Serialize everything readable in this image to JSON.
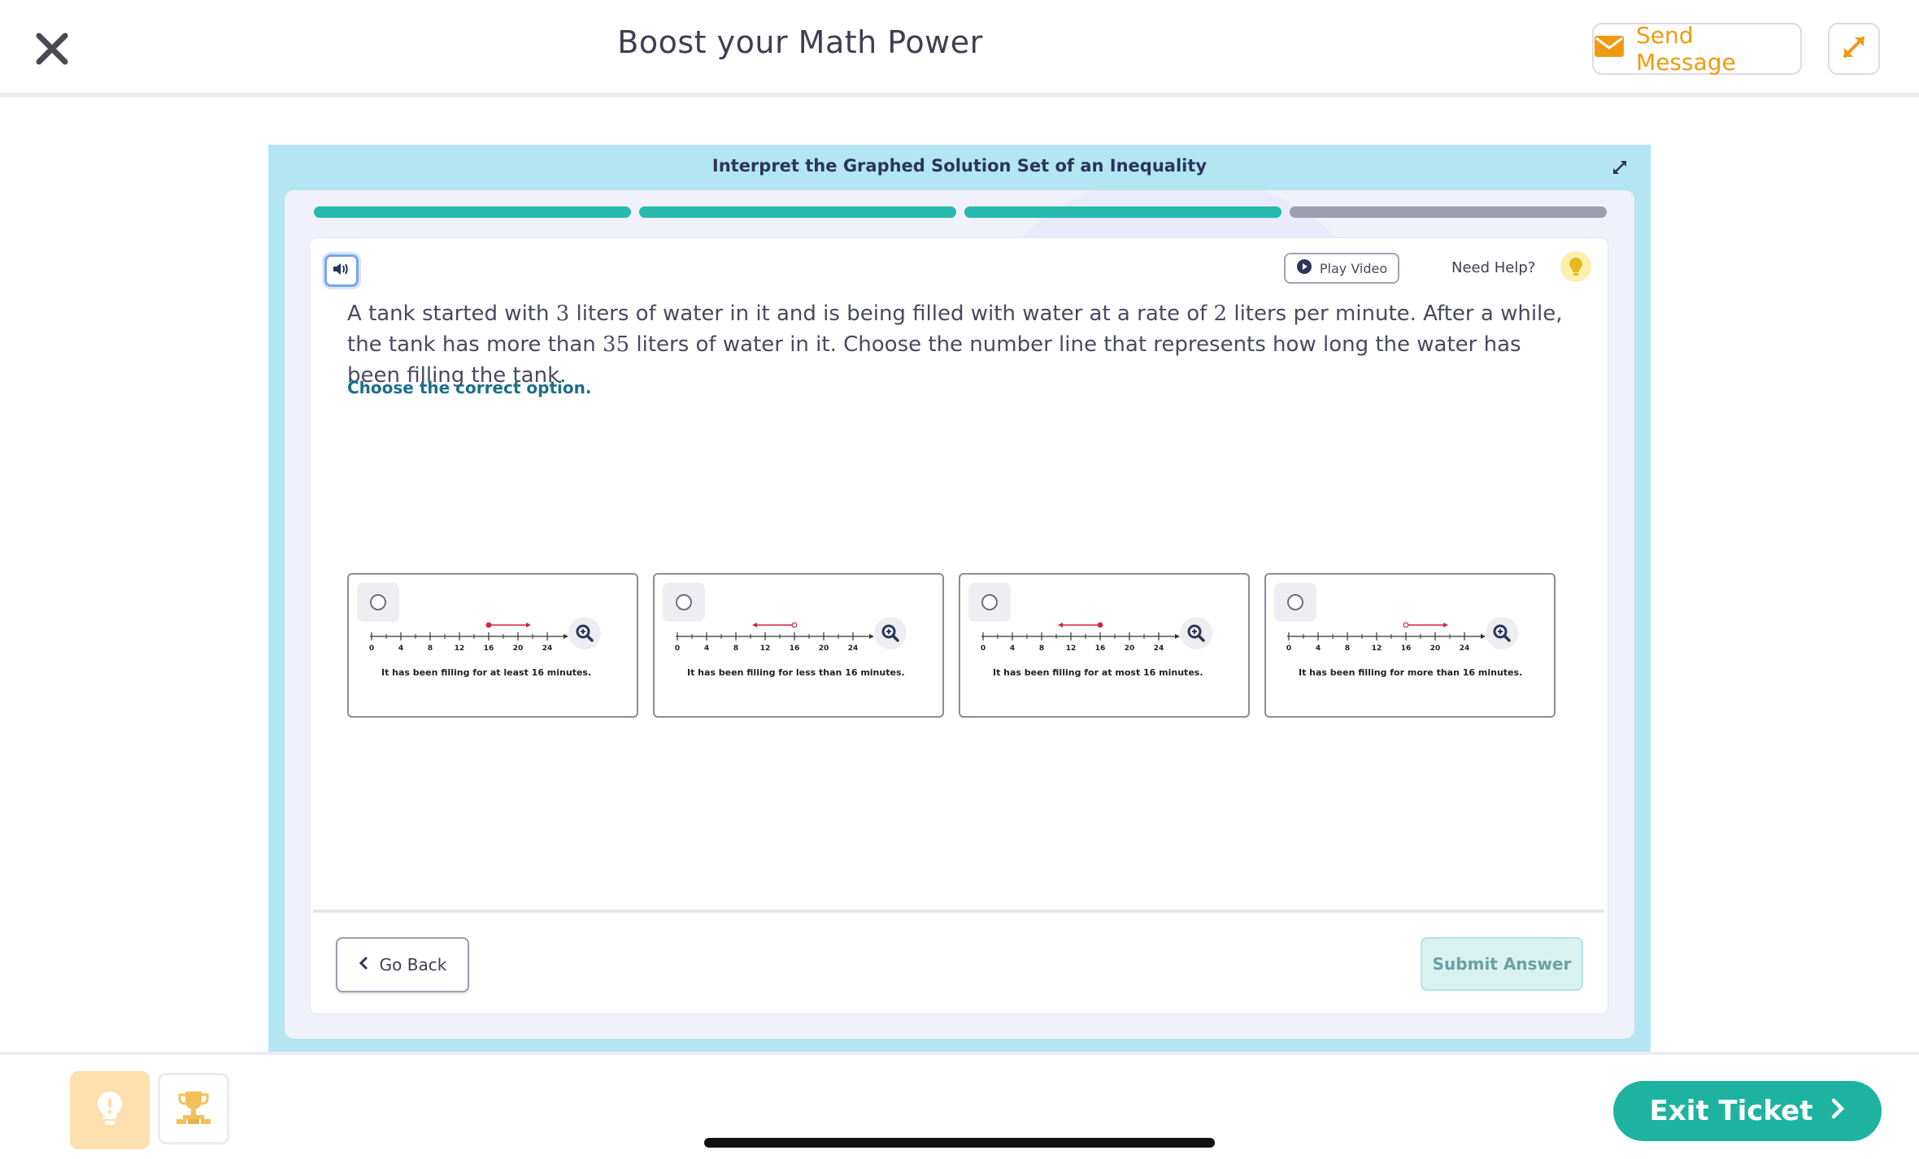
{
  "header": {
    "title": "Boost your Math Power",
    "send_message_label": "Send Message",
    "accent_color": "#f09a12"
  },
  "lesson": {
    "title": "Interpret the Graphed Solution Set of an Inequality",
    "progress": {
      "completed_steps": 3,
      "total_steps": 4
    },
    "play_video_label": "Play Video",
    "need_help_label": "Need Help?",
    "question": {
      "part1": "A tank started with ",
      "n1": "3",
      "part2": " liters of water in it and is being filled with water at a rate of ",
      "n2": "2",
      "part3": " liters per minute. After a while, the tank has more than ",
      "n3": "35",
      "part4": " liters of water in it. Choose the number line that represents how long the water has been filling the tank."
    },
    "instruction": "Choose the correct option.",
    "number_line_ticks": [
      "0",
      "4",
      "8",
      "12",
      "16",
      "20",
      "24"
    ],
    "options": [
      {
        "label": "It has been filling for at least 16 minutes.",
        "direction": "right",
        "endpoint": "closed",
        "value": 16
      },
      {
        "label": "It has been filling for less than 16 minutes.",
        "direction": "left",
        "endpoint": "open",
        "value": 16
      },
      {
        "label": "It has been filling for at most 16 minutes.",
        "direction": "left",
        "endpoint": "closed",
        "value": 16
      },
      {
        "label": "It has been filling for more than 16 minutes.",
        "direction": "right",
        "endpoint": "open",
        "value": 16
      }
    ],
    "go_back_label": "Go Back",
    "submit_label": "Submit Answer"
  },
  "footer": {
    "exit_label": "Exit Ticket",
    "exit_color": "#1eb2a1"
  },
  "icons": [
    "close-icon",
    "envelope-icon",
    "expand-icon",
    "speaker-icon",
    "play-icon",
    "lightbulb-icon",
    "zoom-in-icon",
    "chevron-left-icon",
    "trophy-icon",
    "chevron-right-icon"
  ]
}
